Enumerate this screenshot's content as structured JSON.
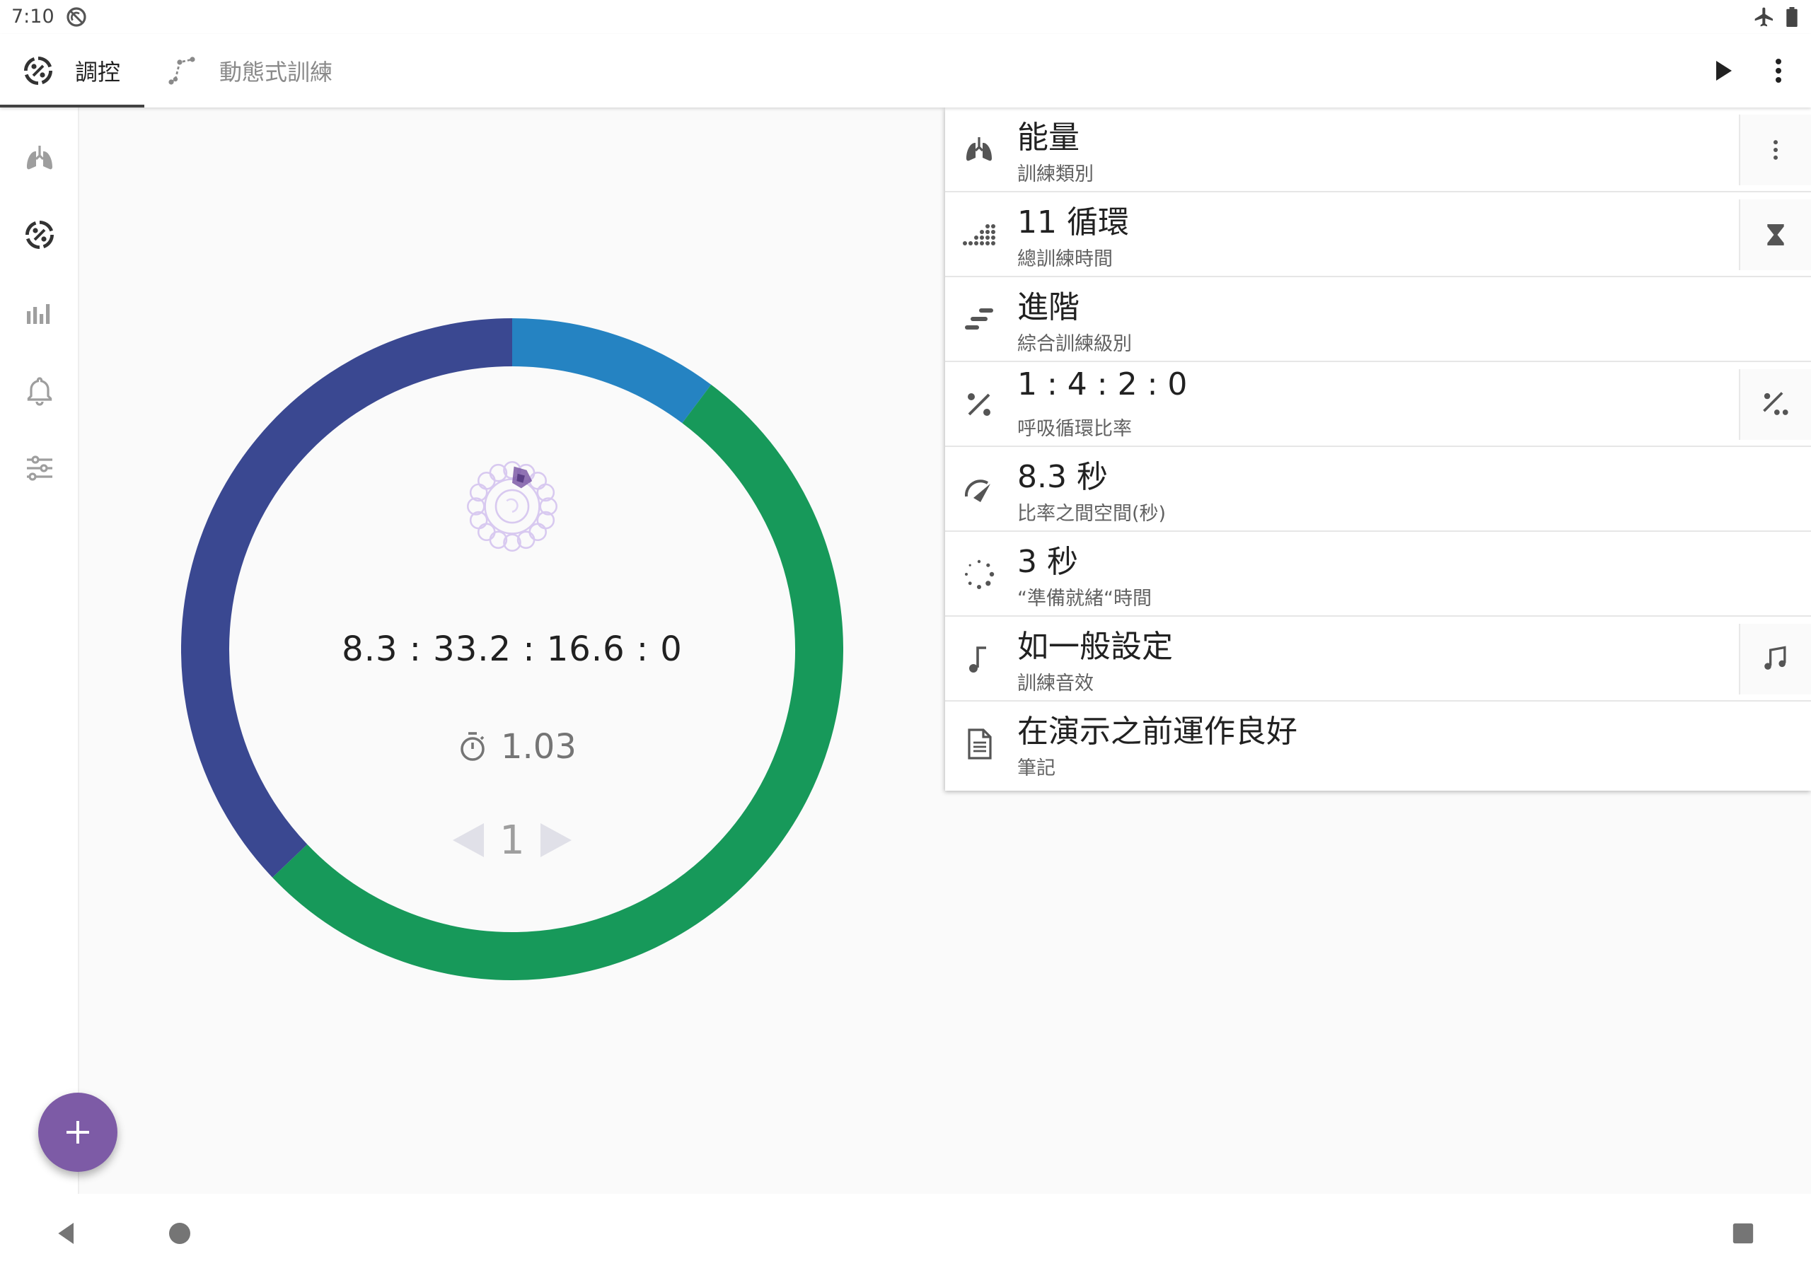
{
  "status_bar": {
    "time": "7:10"
  },
  "tabs": [
    {
      "label": "調控",
      "selected": true
    },
    {
      "label": "動態式訓練",
      "selected": false
    }
  ],
  "main": {
    "ratio_readout": "8.3 : 33.2 : 16.6 : 0",
    "timer_value": "1.03",
    "cycle_number": "1",
    "ring_segments": [
      {
        "phase": "inhale",
        "color": "#2583c2",
        "fraction": 0.1026
      },
      {
        "phase": "hold",
        "color": "#17995a",
        "fraction": 0.5263
      },
      {
        "phase": "exhale",
        "color": "#3a4891",
        "fraction": 0.3711
      }
    ]
  },
  "settings": [
    {
      "icon": "lungs-icon",
      "title": "能量",
      "subtitle": "訓練類別",
      "action": "more-vert-icon"
    },
    {
      "icon": "dots-grid-icon",
      "title": "11 循環",
      "subtitle": "總訓練時間",
      "action": "hourglass-icon"
    },
    {
      "icon": "steps-icon",
      "title": "進階",
      "subtitle": "綜合訓練級別",
      "action": null
    },
    {
      "icon": "percent-icon",
      "title": "1 : 4 : 2 : 0",
      "subtitle": "呼吸循環比率",
      "action": "percent-dots-icon"
    },
    {
      "icon": "speedometer-icon",
      "title": "8.3 秒",
      "subtitle": "比率之間空間(秒)",
      "action": null
    },
    {
      "icon": "spinner-icon",
      "title": "3 秒",
      "subtitle": "“準備就緒“時間",
      "action": null
    },
    {
      "icon": "music-note-icon",
      "title": "如一般設定",
      "subtitle": "訓練音效",
      "action": "music-notes-icon"
    },
    {
      "icon": "document-icon",
      "title": "在演示之前運作良好",
      "subtitle": "筆記",
      "action": null
    }
  ],
  "colors": {
    "inhale": "#2583c2",
    "hold": "#17995a",
    "exhale": "#3a4891",
    "fab": "#7d5ba6",
    "lotus": "#7d5ba6"
  }
}
